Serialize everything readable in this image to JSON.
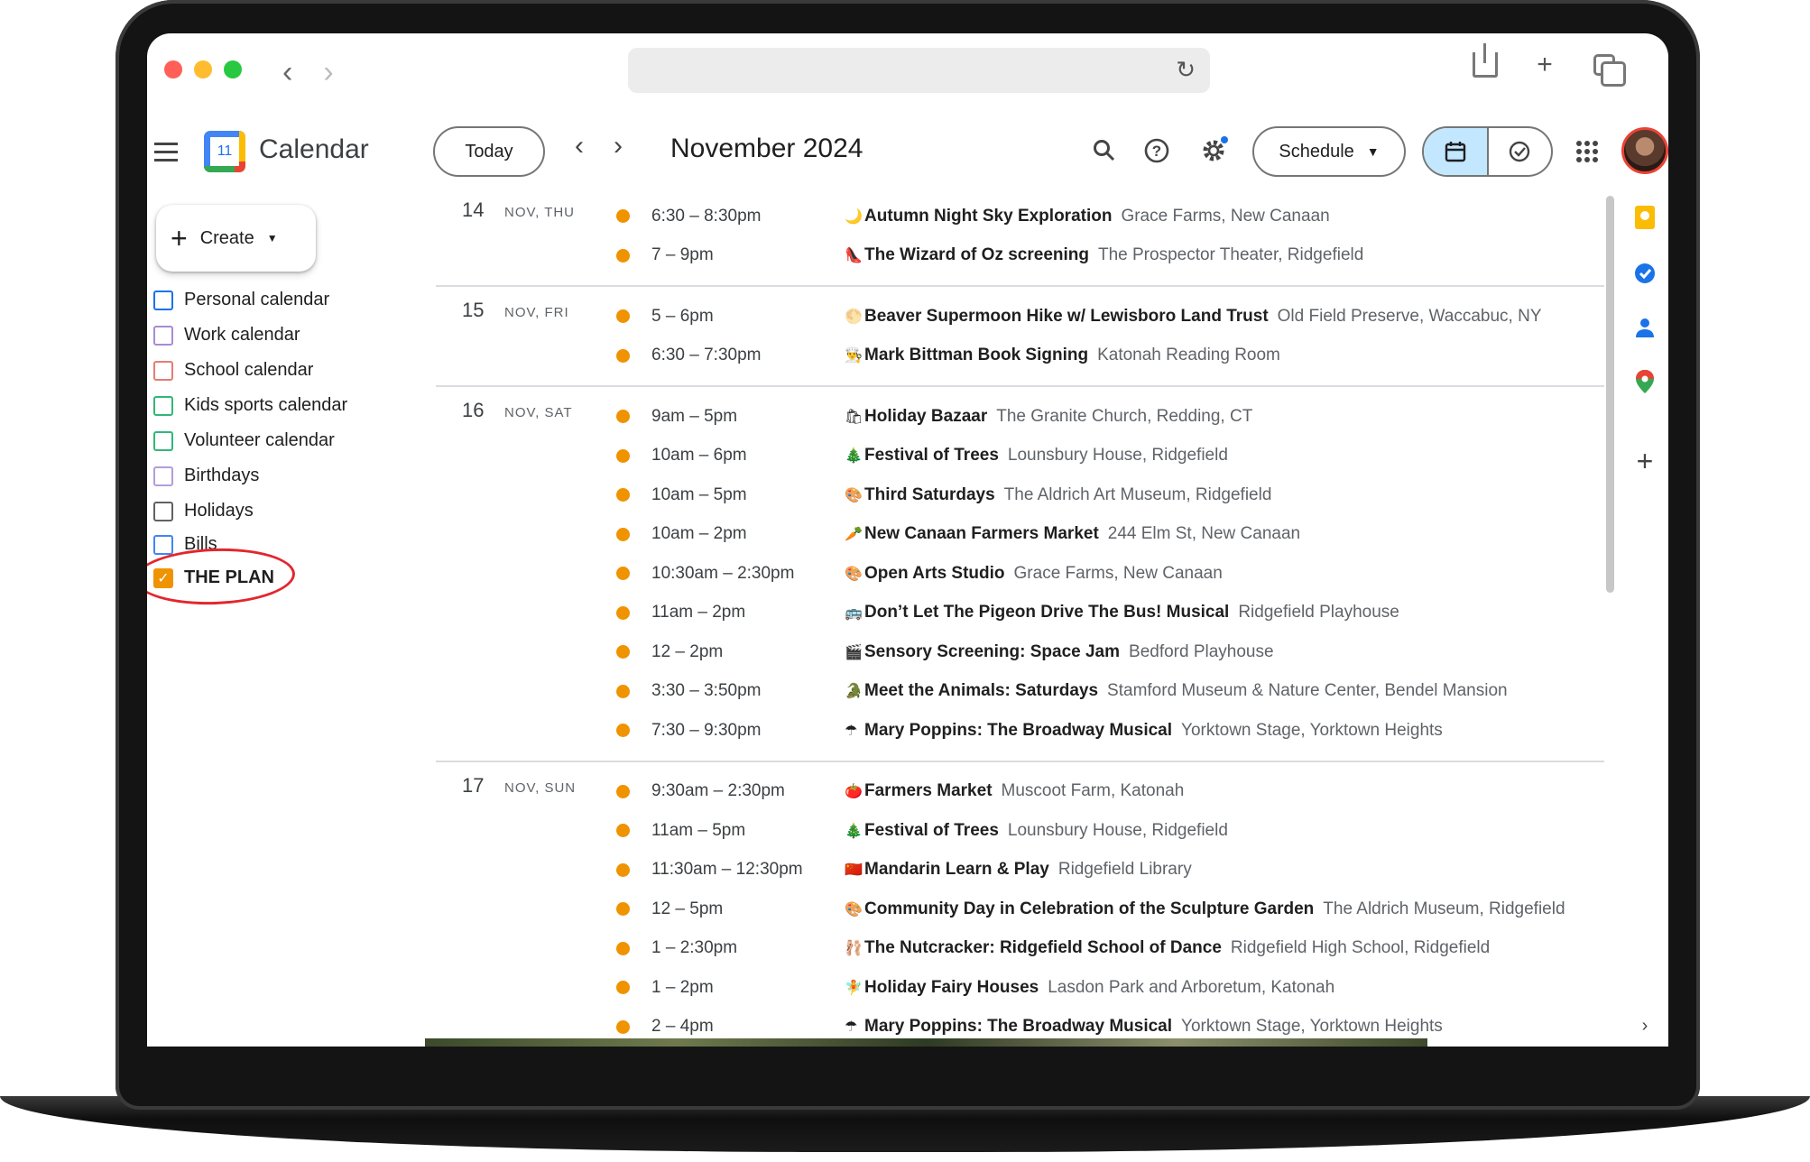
{
  "header": {
    "app_title": "Calendar",
    "logo_day": "11",
    "today_label": "Today",
    "month_title": "November 2024",
    "view_label": "Schedule"
  },
  "sidebar": {
    "create_label": "Create",
    "calendars": [
      {
        "label": "Personal calendar",
        "color": "#1a73e8"
      },
      {
        "label": "Work calendar",
        "color": "#a88bd6"
      },
      {
        "label": "School calendar",
        "color": "#e67c73"
      },
      {
        "label": "Kids sports calendar",
        "color": "#33b679"
      },
      {
        "label": "Volunteer calendar",
        "color": "#33b679"
      },
      {
        "label": "Birthdays",
        "color": "#b39ddb"
      },
      {
        "label": "Holidays",
        "color": "#616161"
      },
      {
        "label": "Bills",
        "color": "#4285f4"
      },
      {
        "label": "THE PLAN",
        "color": "#f09300",
        "checked": true
      }
    ]
  },
  "agenda": [
    {
      "day": "14",
      "label": "NOV, THU",
      "events": [
        {
          "time": "6:30 – 8:30pm",
          "emoji": "🌙",
          "title": "Autumn Night Sky Exploration",
          "location": "Grace Farms, New Canaan"
        },
        {
          "time": "7 – 9pm",
          "emoji": "👠",
          "title": "The Wizard of Oz screening",
          "location": "The Prospector Theater, Ridgefield"
        }
      ]
    },
    {
      "day": "15",
      "label": "NOV, FRI",
      "events": [
        {
          "time": "5 – 6pm",
          "emoji": "🌕",
          "title": "Beaver Supermoon Hike w/ Lewisboro Land Trust",
          "location": "Old Field Preserve, Waccabuc, NY"
        },
        {
          "time": "6:30 – 7:30pm",
          "emoji": "👨‍🍳",
          "title": "Mark Bittman Book Signing",
          "location": "Katonah Reading Room"
        }
      ]
    },
    {
      "day": "16",
      "label": "NOV, SAT",
      "events": [
        {
          "time": "9am – 5pm",
          "emoji": "🛍",
          "title": "Holiday Bazaar",
          "location": "The Granite Church, Redding, CT"
        },
        {
          "time": "10am – 6pm",
          "emoji": "🎄",
          "title": "Festival of Trees",
          "location": "Lounsbury House, Ridgefield"
        },
        {
          "time": "10am – 5pm",
          "emoji": "🎨",
          "title": "Third Saturdays",
          "location": "The Aldrich Art Museum, Ridgefield"
        },
        {
          "time": "10am – 2pm",
          "emoji": "🥕",
          "title": "New Canaan Farmers Market",
          "location": "244 Elm St, New Canaan"
        },
        {
          "time": "10:30am – 2:30pm",
          "emoji": "🎨",
          "title": "Open Arts Studio",
          "location": "Grace Farms, New Canaan"
        },
        {
          "time": "11am – 2pm",
          "emoji": "🚌",
          "title": "Don’t Let The Pigeon Drive The Bus! Musical",
          "location": "Ridgefield Playhouse"
        },
        {
          "time": "12 – 2pm",
          "emoji": "🎬",
          "title": "Sensory Screening: Space Jam",
          "location": "Bedford Playhouse"
        },
        {
          "time": "3:30 – 3:50pm",
          "emoji": "🐊",
          "title": "Meet the Animals: Saturdays",
          "location": "Stamford Museum & Nature Center, Bendel Mansion"
        },
        {
          "time": "7:30 – 9:30pm",
          "emoji": "☂",
          "title": "Mary Poppins: The Broadway Musical",
          "location": "Yorktown Stage, Yorktown Heights"
        }
      ]
    },
    {
      "day": "17",
      "label": "NOV, SUN",
      "events": [
        {
          "time": "9:30am – 2:30pm",
          "emoji": "🍅",
          "title": "Farmers Market",
          "location": "Muscoot Farm, Katonah"
        },
        {
          "time": "11am – 5pm",
          "emoji": "🎄",
          "title": "Festival of Trees",
          "location": "Lounsbury House, Ridgefield"
        },
        {
          "time": "11:30am – 12:30pm",
          "emoji": "🇨🇳",
          "title": "Mandarin Learn & Play",
          "location": "Ridgefield Library"
        },
        {
          "time": "12 – 5pm",
          "emoji": "🎨",
          "title": "Community Day in Celebration of the Sculpture Garden",
          "location": "The Aldrich Museum, Ridgefield"
        },
        {
          "time": "1 – 2:30pm",
          "emoji": "🩰",
          "title": "The Nutcracker: Ridgefield School of Dance",
          "location": "Ridgefield High School, Ridgefield"
        },
        {
          "time": "1 – 2pm",
          "emoji": "🧚",
          "title": "Holiday Fairy Houses",
          "location": "Lasdon Park and Arboretum, Katonah"
        },
        {
          "time": "2 – 4pm",
          "emoji": "☂",
          "title": "Mary Poppins: The Broadway Musical",
          "location": "Yorktown Stage, Yorktown Heights"
        }
      ]
    }
  ],
  "colors": {
    "event_dot": "#f09300",
    "accent": "#1a73e8",
    "selected_view": "#c2e7ff",
    "annotation": "#e3262d"
  }
}
